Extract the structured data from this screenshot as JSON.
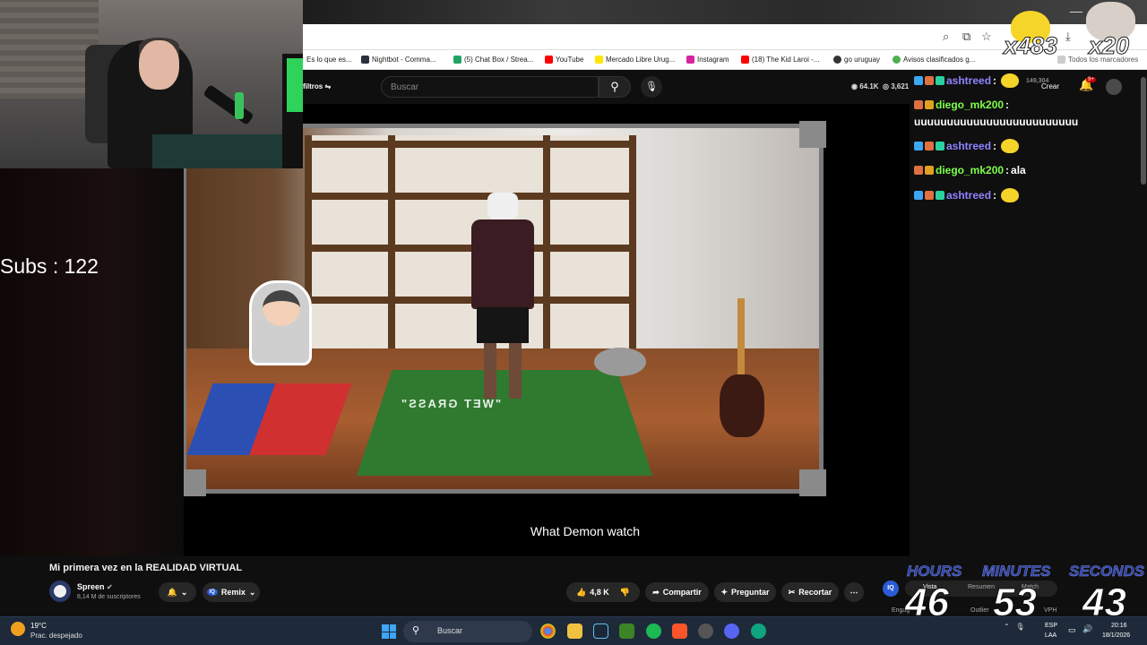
{
  "browser": {
    "bookmarks": [
      {
        "label": "Es lo que es...",
        "color": "#6b6b6b"
      },
      {
        "label": "Nightbot - Comma...",
        "color": "#2a3140"
      },
      {
        "label": "(5) Chat Box / Strea...",
        "color": "#1fa463"
      },
      {
        "label": "YouTube",
        "color": "#ff0000"
      },
      {
        "label": "Mercado Libre Urug...",
        "color": "#ffe600"
      },
      {
        "label": "Instagram",
        "color": "#d6249f"
      },
      {
        "label": "(18) The Kid Laroi -...",
        "color": "#ff0000"
      },
      {
        "label": "go uruguay",
        "color": "#333333"
      },
      {
        "label": "Avisos clasificados g...",
        "color": "#4caf50"
      }
    ],
    "other_bookmarks": "Todos los marcadores"
  },
  "youtube_header": {
    "filters": "filtros",
    "search_placeholder": "Buscar",
    "viewers": "64.1K",
    "viewers2": "3,621",
    "create": "Crear",
    "notifications": "9+"
  },
  "stream_overlay": {
    "subs": "Subs : 122",
    "caption": "What Demon watch",
    "counter_bee": "x483",
    "counter_pete": "x20",
    "partial_count": "149,304"
  },
  "chat": [
    {
      "user": "ashtreed",
      "sep": " :",
      "message": "",
      "emote": true,
      "type": "a"
    },
    {
      "user": "diego_mk200",
      "sep": " :",
      "message": "",
      "emote": false,
      "type": "d"
    },
    {
      "user": "",
      "sep": "",
      "message": "uuuuuuuuuuuuuuuuuuuuuuuuu",
      "emote": false,
      "type": "m"
    },
    {
      "user": "ashtreed",
      "sep": " :",
      "message": "",
      "emote": true,
      "type": "a"
    },
    {
      "user": "diego_mk200",
      "sep": " :",
      "message": " ala",
      "emote": false,
      "type": "d"
    },
    {
      "user": "ashtreed",
      "sep": " :",
      "message": "",
      "emote": true,
      "type": "a"
    }
  ],
  "video": {
    "title": "Mi primera vez en la REALIDAD VIRTUAL",
    "channel": "Spreen",
    "subscribers": "8,14 M de suscriptores",
    "remix": "Remix",
    "likes": "4,8 K",
    "share": "Compartir",
    "ask": "Preguntar",
    "clip": "Recortar",
    "iq": "IQ",
    "tabs": [
      "Vista",
      "Resumen",
      "Match"
    ],
    "row_labels": [
      "Engag",
      "Outlier",
      "VPH"
    ],
    "rug_text": "\"WET GRASS\""
  },
  "timer": {
    "hours_label": "HOURS",
    "minutes_label": "MINUTES",
    "seconds_label": "SECONDS",
    "hours": "46",
    "minutes": "53",
    "seconds": "43"
  },
  "taskbar": {
    "temperature": "19°C",
    "weather_desc": "Prac. despejado",
    "search": "Buscar",
    "lang": "ESP",
    "region": "LAA",
    "time": "20:16",
    "date": "18/1/2026"
  }
}
